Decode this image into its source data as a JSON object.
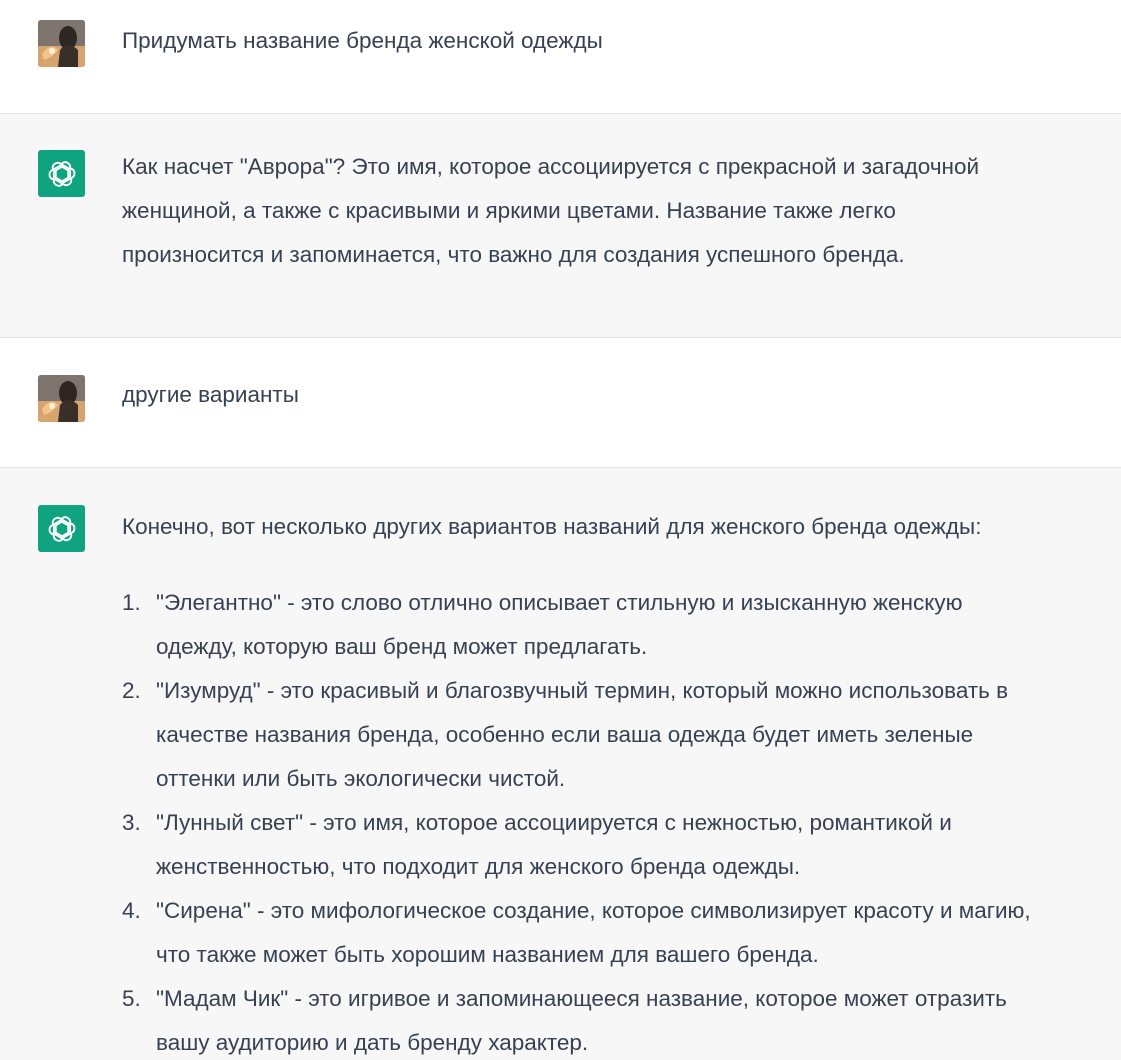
{
  "messages": [
    {
      "role": "user",
      "avatar_icon": "user-photo-avatar",
      "text": "Придумать название бренда женской одежды"
    },
    {
      "role": "assistant",
      "avatar_icon": "openai-logo-icon",
      "text_lines": [
        "Как насчет \"Аврора\"? Это имя, которое ассоциируется с прекрасной и загадочной",
        "женщиной, а также с красивыми и яркими цветами. Название также легко",
        "произносится и запоминается, что важно для создания успешного бренда."
      ]
    },
    {
      "role": "user",
      "avatar_icon": "user-photo-avatar",
      "text": "другие варианты"
    },
    {
      "role": "assistant",
      "avatar_icon": "openai-logo-icon",
      "intro": "Конечно, вот несколько других вариантов названий для женского бренда одежды:",
      "list": [
        {
          "num": "1.",
          "lines": [
            "\"Элегантно\" - это слово отлично описывает стильную и изысканную женскую",
            "одежду, которую ваш бренд может предлагать."
          ]
        },
        {
          "num": "2.",
          "lines": [
            "\"Изумруд\" - это красивый и благозвучный термин, который можно использовать в",
            "качестве названия бренда, особенно если ваша одежда будет иметь зеленые",
            "оттенки или быть экологически чистой."
          ]
        },
        {
          "num": "3.",
          "lines": [
            "\"Лунный свет\" - это имя, которое ассоциируется с нежностью, романтикой и",
            "женственностью, что подходит для женского бренда одежды."
          ]
        },
        {
          "num": "4.",
          "lines": [
            "\"Сирена\" - это мифологическое создание, которое символизирует красоту и магию,",
            "что также может быть хорошим названием для вашего бренда."
          ]
        },
        {
          "num": "5.",
          "lines": [
            "\"Мадам Чик\" - это игривое и запоминающееся название, которое может отразить",
            "вашу аудиторию и дать бренду характер."
          ]
        }
      ]
    }
  ],
  "colors": {
    "assistant_bg": "#f7f7f8",
    "user_bg": "#ffffff",
    "text": "#374151",
    "openai_green": "#10a37f",
    "divider": "#e2e2e5"
  }
}
